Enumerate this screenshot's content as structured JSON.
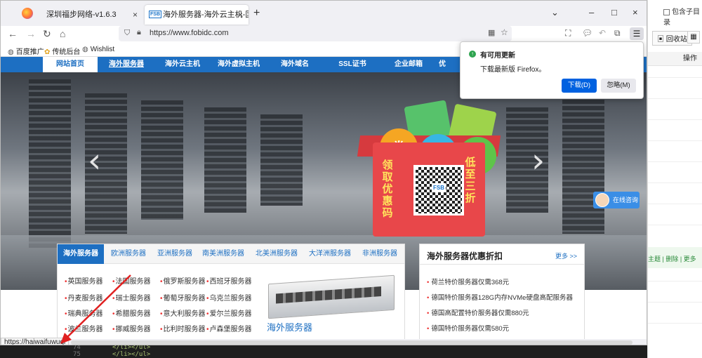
{
  "browser": {
    "tabs": [
      {
        "label": "深圳福步网络-v1.6.3"
      },
      {
        "label": "海外服务器-海外云主机-国外VPS",
        "favicon": "FSB"
      }
    ],
    "new_tab": "+",
    "window_controls": {
      "chevron": "⌄",
      "minimize": "–",
      "maximize": "□",
      "close": "×"
    },
    "url": "https://www.fobidc.com",
    "bookmarks": [
      "百度推广",
      "传统后台",
      "Wishlist"
    ],
    "status_url": "https://haiwaifuwuqi"
  },
  "site": {
    "nav": [
      "网站首页",
      "海外服务器",
      "海外云主机",
      "海外虚拟主机",
      "海外域名",
      "SSL证书",
      "企业邮箱",
      "优"
    ],
    "banner": {
      "coupon_label": "券",
      "left_text": "领取优惠码",
      "right_text": "低至三折",
      "qr_logo": "FSB"
    },
    "chat_label": "在线咨询",
    "region_tabs": [
      "海外服务器",
      "欧洲服务器",
      "亚洲服务器",
      "南美洲服务器",
      "北美洲服务器",
      "大洋洲服务器",
      "非洲服务器"
    ],
    "server_links": [
      [
        "英国服务器",
        "法国服务器",
        "俄罗斯服务器",
        "西班牙服务器"
      ],
      [
        "丹麦服务器",
        "瑞士服务器",
        "葡萄牙服务器",
        "乌克兰服务器"
      ],
      [
        "瑞典服务器",
        "希腊服务器",
        "意大利服务器",
        "爱尔兰服务器"
      ],
      [
        "波兰服务器",
        "挪威服务器",
        "比利时服务器",
        "卢森堡服务器"
      ]
    ],
    "server_title": "海外服务器",
    "promo": {
      "title": "海外服务器优惠折扣",
      "more": "更多 >>",
      "items": [
        "荷兰特价服务器仅需368元",
        "德国特价服务器128G内存NVMe硬盘高配服务器",
        "德国高配置特价服务器仅需880元",
        "德国特价服务器仅需580元"
      ]
    }
  },
  "update_popup": {
    "title": "有可用更新",
    "body": "下载最新版 Firefox。",
    "download": "下载(D)",
    "ignore": "忽略(M)"
  },
  "background_app": {
    "checkbox_label": "包含子目录",
    "recycle_label": "回收站",
    "column_header": "操作",
    "row_links": "主题 | 删除 | 更多"
  },
  "editor": {
    "line_numbers": [
      "74",
      "75"
    ],
    "code_lines": [
      "</li></ul>",
      "</li></ul>"
    ]
  },
  "colors": {
    "site_blue": "#1d6fc2",
    "accent_red": "#e33",
    "firefox_blue": "#0061e0"
  }
}
